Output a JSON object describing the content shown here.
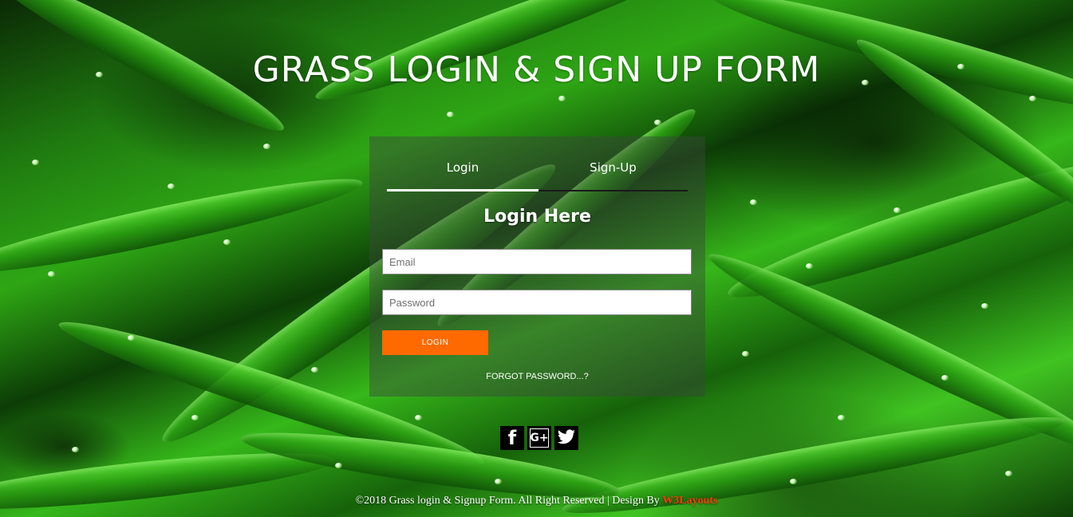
{
  "page": {
    "title": "GRASS LOGIN & SIGN UP FORM"
  },
  "tabs": [
    {
      "label": "Login",
      "active": true
    },
    {
      "label": "Sign-Up",
      "active": false
    }
  ],
  "login_form": {
    "heading": "Login Here",
    "email_placeholder": "Email",
    "email_value": "",
    "password_placeholder": "Password",
    "password_value": "",
    "submit_label": "LOGIN",
    "forgot_label": "FORGOT PASSWORD...?"
  },
  "social": [
    {
      "icon": "facebook-icon",
      "glyph": "f"
    },
    {
      "icon": "google-plus-icon",
      "glyph": "G+"
    },
    {
      "icon": "twitter-icon"
    }
  ],
  "footer": {
    "text": "©2018 Grass login & Signup Form. All Right Reserved | Design By ",
    "link_label": "W3Layouts"
  },
  "colors": {
    "accent_button": "#ff6a00",
    "footer_link": "#ff3d00",
    "panel_bg": "rgba(60,70,60,0.45)",
    "grass_green": "#2ea614"
  }
}
